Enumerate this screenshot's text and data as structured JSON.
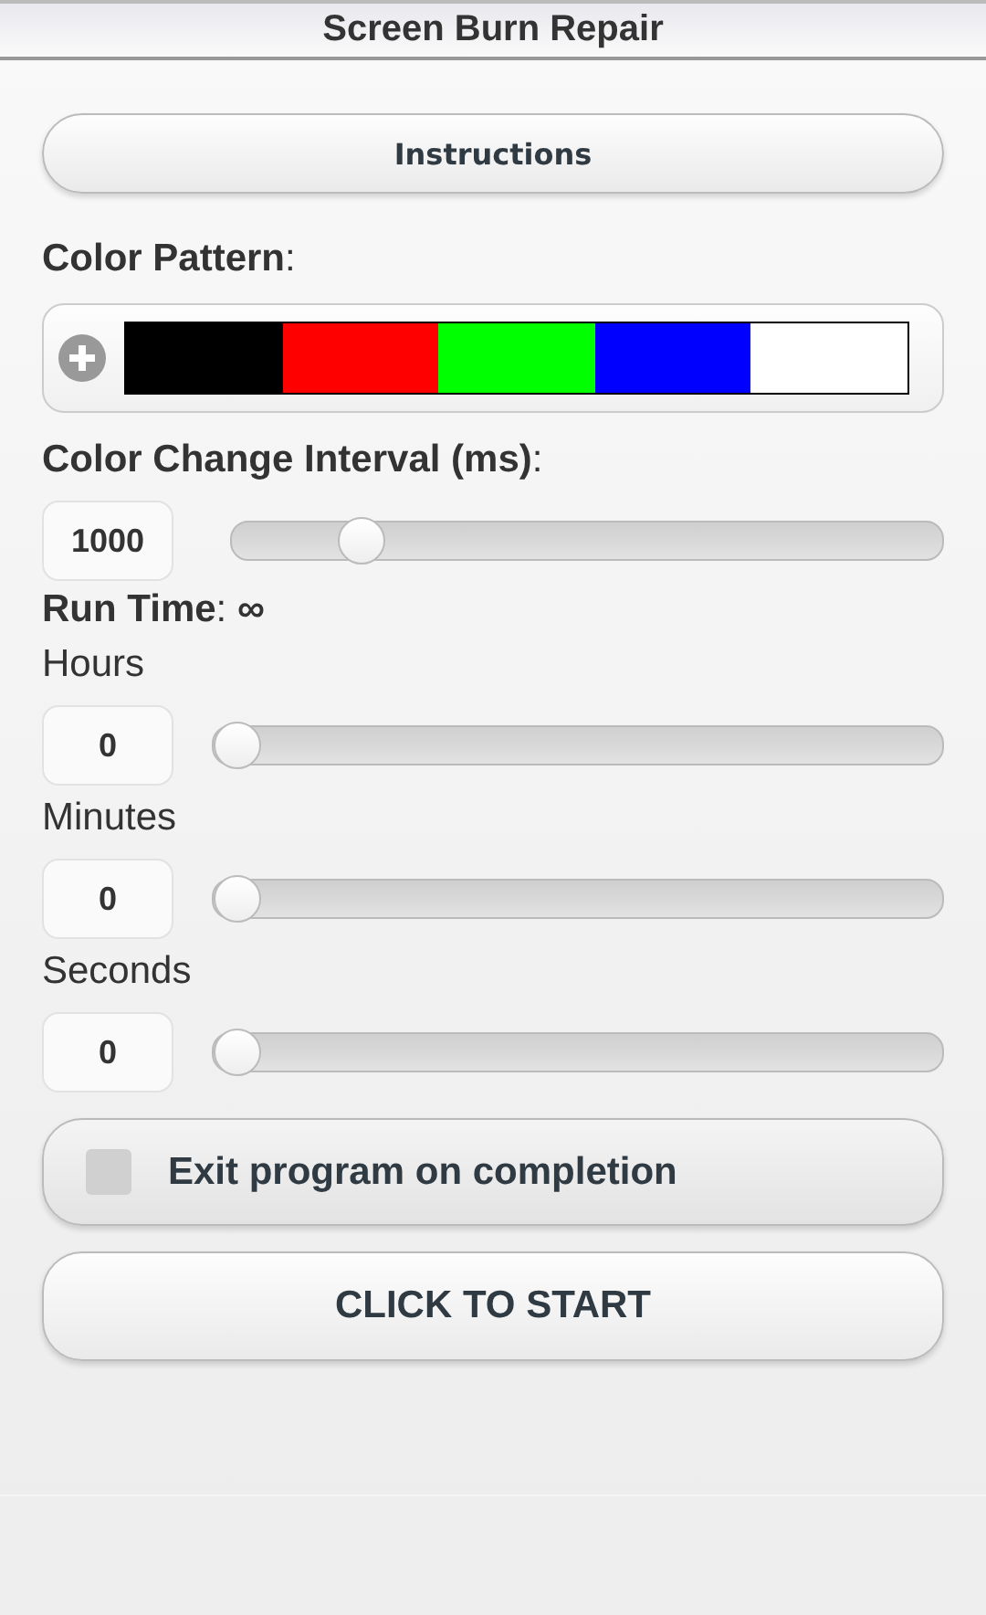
{
  "header": {
    "title": "Screen Burn Repair"
  },
  "instructions_button": "Instructions",
  "color_pattern": {
    "label": "**Color Pattern**:",
    "swatches": [
      {
        "color": "#000000"
      },
      {
        "color": "#ff0000"
      },
      {
        "color": "#00ff00"
      },
      {
        "color": "#0000ff"
      },
      {
        "color": "#ffffff"
      }
    ]
  },
  "interval": {
    "label": "**Color Change Interval (ms)**:",
    "value": "1000",
    "level": 0.16
  },
  "run_time": {
    "label": "**Run Time**: **∞**",
    "fields": [
      {
        "label": "Hours",
        "value": "0",
        "level": 0
      },
      {
        "label": "Minutes",
        "value": "0",
        "level": 0
      },
      {
        "label": "Seconds",
        "value": "0",
        "level": 0
      }
    ]
  },
  "exit_option": {
    "label": "Exit program on completion",
    "checked": false
  },
  "start_button": "CLICK TO START"
}
